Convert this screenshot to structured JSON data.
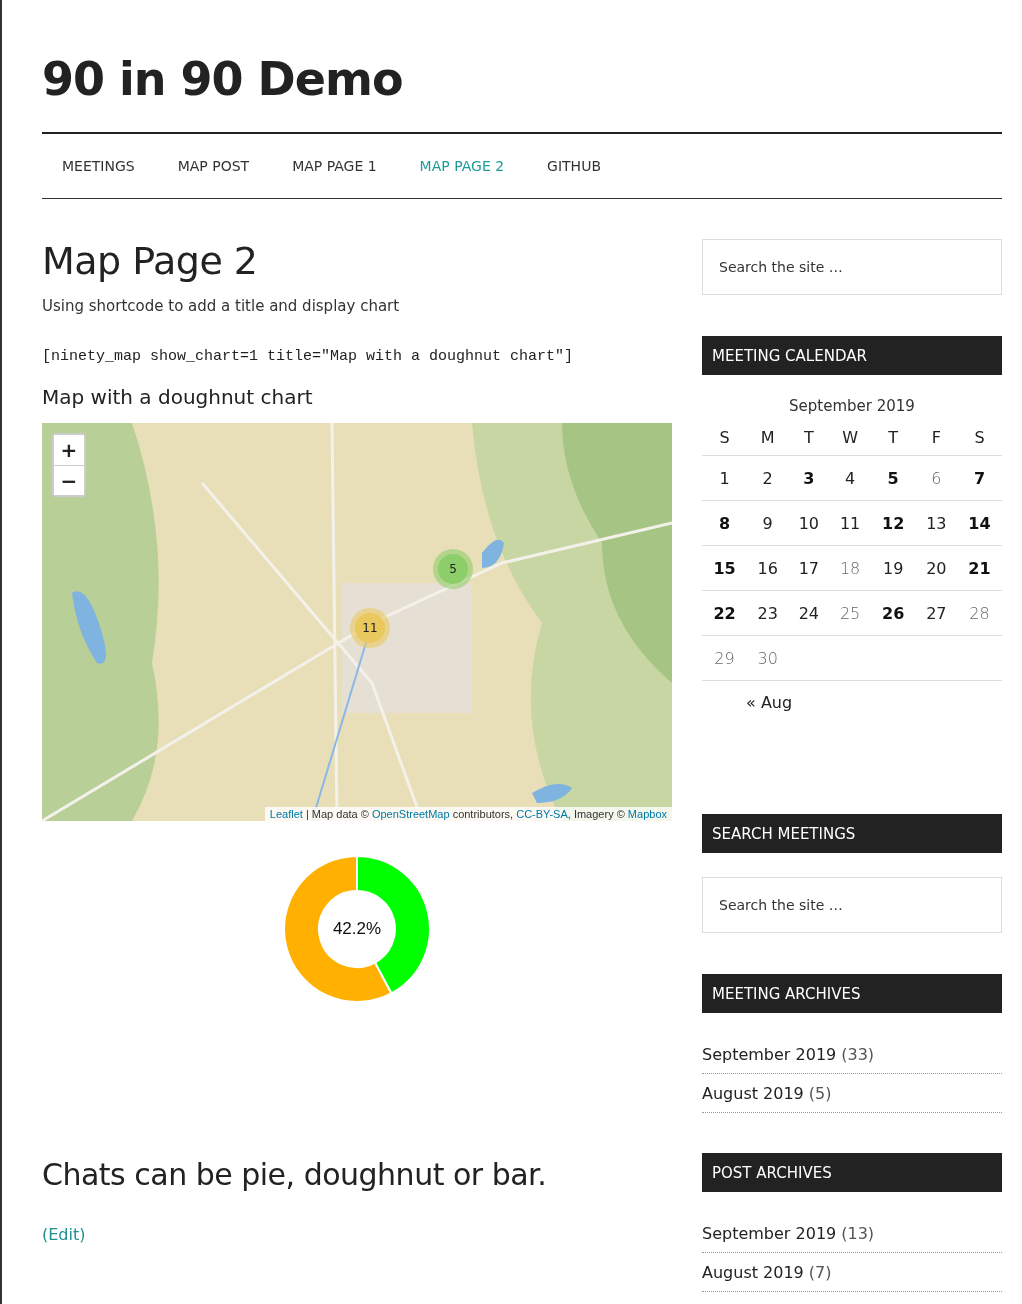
{
  "site_title": "90 in 90 Demo",
  "nav": {
    "items": [
      {
        "label": "MEETINGS",
        "selected": false
      },
      {
        "label": "MAP POST",
        "selected": false
      },
      {
        "label": "MAP PAGE 1",
        "selected": false
      },
      {
        "label": "MAP PAGE 2",
        "selected": true
      },
      {
        "label": "GITHUB",
        "selected": false
      }
    ]
  },
  "page": {
    "title": "Map Page 2",
    "intro": "Using shortcode to add a title and display chart",
    "shortcode": "[ninety_map show_chart=1 title=\"Map with a doughnut chart\"]",
    "map_title": "Map with a doughnut chart",
    "map": {
      "kind": "picture",
      "zoom_in": "+",
      "zoom_out": "−",
      "clusters": [
        {
          "count": "5",
          "color": "#8dce6b"
        },
        {
          "count": "11",
          "color": "#e9c85e"
        }
      ],
      "attribution": [
        {
          "kind": "link",
          "text": "Leaflet"
        },
        {
          "kind": "text",
          "text": " | Map data © "
        },
        {
          "kind": "link",
          "text": "OpenStreetMap"
        },
        {
          "kind": "text",
          "text": " contributors, "
        },
        {
          "kind": "link",
          "text": "CC-BY-SA"
        },
        {
          "kind": "text",
          "text": ", Imagery © "
        },
        {
          "kind": "link",
          "text": "Mapbox"
        }
      ]
    },
    "chart_center": "42.2%",
    "chart_data": {
      "type": "donut",
      "values": [
        42.2,
        57.8
      ],
      "colors": [
        "#00ff00",
        "#ffb000"
      ]
    },
    "footer_heading": "Chats can be pie, doughnut or bar.",
    "edit_link": "(Edit)"
  },
  "sidebar": {
    "search": {
      "placeholder": "Search the site …"
    },
    "calendar": {
      "title": "MEETING CALENDAR",
      "caption": "September 2019",
      "weekdays": [
        "S",
        "M",
        "T",
        "W",
        "T",
        "F",
        "S"
      ],
      "weeks": [
        {
          "days": [
            {
              "day": "1",
              "bold": false,
              "dimmed": false
            },
            {
              "day": "2",
              "bold": false,
              "dimmed": false
            },
            {
              "day": "3",
              "bold": true,
              "dimmed": false
            },
            {
              "day": "4",
              "bold": false,
              "dimmed": false
            },
            {
              "day": "5",
              "bold": true,
              "dimmed": false
            },
            {
              "day": "6",
              "bold": false,
              "dimmed": true
            },
            {
              "day": "7",
              "bold": true,
              "dimmed": false
            }
          ]
        },
        {
          "days": [
            {
              "day": "8",
              "bold": true,
              "dimmed": false
            },
            {
              "day": "9",
              "bold": false,
              "dimmed": false
            },
            {
              "day": "10",
              "bold": false,
              "dimmed": false
            },
            {
              "day": "11",
              "bold": false,
              "dimmed": false
            },
            {
              "day": "12",
              "bold": true,
              "dimmed": false
            },
            {
              "day": "13",
              "bold": false,
              "dimmed": false
            },
            {
              "day": "14",
              "bold": true,
              "dimmed": false
            }
          ]
        },
        {
          "days": [
            {
              "day": "15",
              "bold": true,
              "dimmed": false
            },
            {
              "day": "16",
              "bold": false,
              "dimmed": false
            },
            {
              "day": "17",
              "bold": false,
              "dimmed": false
            },
            {
              "day": "18",
              "bold": false,
              "dimmed": true
            },
            {
              "day": "19",
              "bold": false,
              "dimmed": false
            },
            {
              "day": "20",
              "bold": false,
              "dimmed": false
            },
            {
              "day": "21",
              "bold": true,
              "dimmed": false
            }
          ]
        },
        {
          "days": [
            {
              "day": "22",
              "bold": true,
              "dimmed": false
            },
            {
              "day": "23",
              "bold": false,
              "dimmed": false
            },
            {
              "day": "24",
              "bold": false,
              "dimmed": false
            },
            {
              "day": "25",
              "bold": false,
              "dimmed": true
            },
            {
              "day": "26",
              "bold": true,
              "dimmed": false
            },
            {
              "day": "27",
              "bold": false,
              "dimmed": false
            },
            {
              "day": "28",
              "bold": false,
              "dimmed": true
            }
          ]
        },
        {
          "days": [
            {
              "day": "29",
              "bold": false,
              "dimmed": true
            },
            {
              "day": "30",
              "bold": false,
              "dimmed": true
            }
          ]
        }
      ],
      "prev_link": "« Aug"
    },
    "search_meetings": {
      "title": "SEARCH MEETINGS",
      "placeholder": "Search the site …"
    },
    "archives": [
      {
        "title": "MEETING ARCHIVES",
        "items": [
          {
            "label": "September 2019",
            "count": "(33)"
          },
          {
            "label": "August 2019",
            "count": "(5)"
          }
        ]
      },
      {
        "title": "POST ARCHIVES",
        "items": [
          {
            "label": "September 2019",
            "count": "(13)"
          },
          {
            "label": "August 2019",
            "count": "(7)"
          }
        ]
      }
    ]
  }
}
